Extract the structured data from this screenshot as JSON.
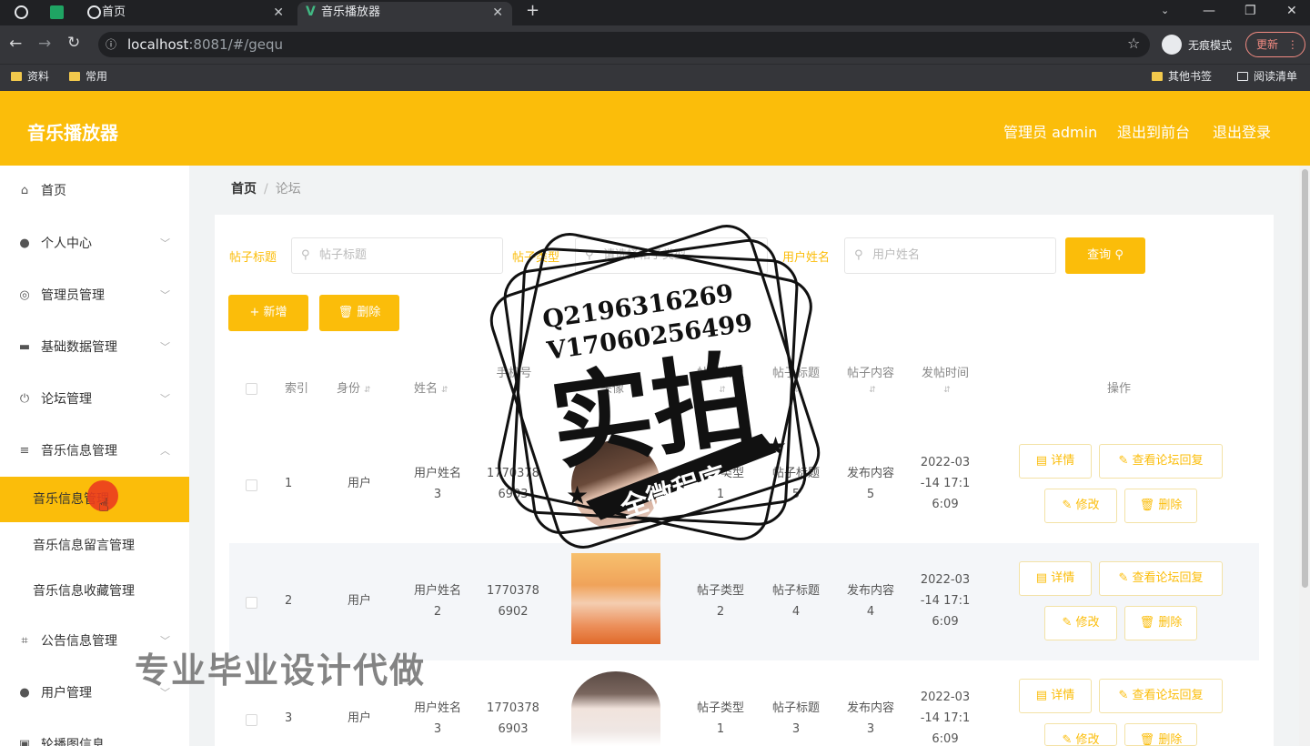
{
  "browser": {
    "tabs": [
      {
        "label": "首页"
      },
      {
        "label": "音乐播放器"
      }
    ],
    "url_host": "localhost",
    "url_path": ":8081/#/gequ",
    "profile": "无痕模式",
    "update": "更新",
    "bookmarks": [
      "资料",
      "常用"
    ],
    "bookmarks_right": [
      "其他书签",
      "阅读清单"
    ]
  },
  "header": {
    "brand": "音乐播放器",
    "admin": "管理员 admin",
    "to_front": "退出到前台",
    "logout": "退出登录"
  },
  "sidebar": {
    "items": [
      {
        "label": "首页",
        "icon": "home-icon"
      },
      {
        "label": "个人中心",
        "icon": "user-icon"
      },
      {
        "label": "管理员管理",
        "icon": "compass-icon"
      },
      {
        "label": "基础数据管理",
        "icon": "monitor-icon"
      },
      {
        "label": "论坛管理",
        "icon": "power-icon"
      },
      {
        "label": "音乐信息管理",
        "icon": "menu-icon"
      }
    ],
    "sub_items": [
      "音乐信息管理",
      "音乐信息留言管理",
      "音乐信息收藏管理"
    ],
    "items_after": [
      {
        "label": "公告信息管理",
        "icon": "crop-icon"
      },
      {
        "label": "用户管理",
        "icon": "user-icon"
      },
      {
        "label": "轮播图信息",
        "icon": "image-icon"
      }
    ]
  },
  "breadcrumb": {
    "home": "首页",
    "sep": "/",
    "current": "论坛"
  },
  "filters": {
    "title_label": "帖子标题",
    "title_placeholder": "帖子标题",
    "type_label": "帖子类型",
    "type_placeholder": "请选择帖子类型",
    "user_label": "用户姓名",
    "user_placeholder": "用户姓名",
    "query": "查询"
  },
  "actions": {
    "add": "新增",
    "delete": "删除"
  },
  "table": {
    "headers": [
      "索引",
      "身份",
      "姓名",
      "手机号",
      "头像",
      "帖子类型",
      "帖子标题",
      "帖子内容",
      "发帖时间",
      "操作"
    ],
    "rows": [
      {
        "index": "1",
        "role": "用户",
        "name1": "用户姓名",
        "name2": "3",
        "phone1": "1770378",
        "phone2": "6903",
        "type1": "帖子类型",
        "type2": "1",
        "title1": "帖子标题",
        "title2": "5",
        "content1": "发布内容",
        "content2": "5",
        "time1": "2022-03",
        "time2": "-14 17:1",
        "time3": "6:09"
      },
      {
        "index": "2",
        "role": "用户",
        "name1": "用户姓名",
        "name2": "2",
        "phone1": "1770378",
        "phone2": "6902",
        "type1": "帖子类型",
        "type2": "2",
        "title1": "帖子标题",
        "title2": "4",
        "content1": "发布内容",
        "content2": "4",
        "time1": "2022-03",
        "time2": "-14 17:1",
        "time3": "6:09"
      },
      {
        "index": "3",
        "role": "用户",
        "name1": "用户姓名",
        "name2": "3",
        "phone1": "1770378",
        "phone2": "6903",
        "type1": "帖子类型",
        "type2": "1",
        "title1": "帖子标题",
        "title2": "3",
        "content1": "发布内容",
        "content2": "3",
        "time1": "2022-03",
        "time2": "-14 17:1",
        "time3": "6:09"
      }
    ],
    "btn_detail": "详情",
    "btn_reply": "查看论坛回复",
    "btn_edit": "修改",
    "btn_delete": "删除"
  },
  "watermark": {
    "qq": "Q2196316269",
    "vx": "V17060256499",
    "big": "实拍",
    "band": "全微程序",
    "bottom": "专业毕业设计代做"
  },
  "colors": {
    "accent": "#fbbd0a"
  }
}
